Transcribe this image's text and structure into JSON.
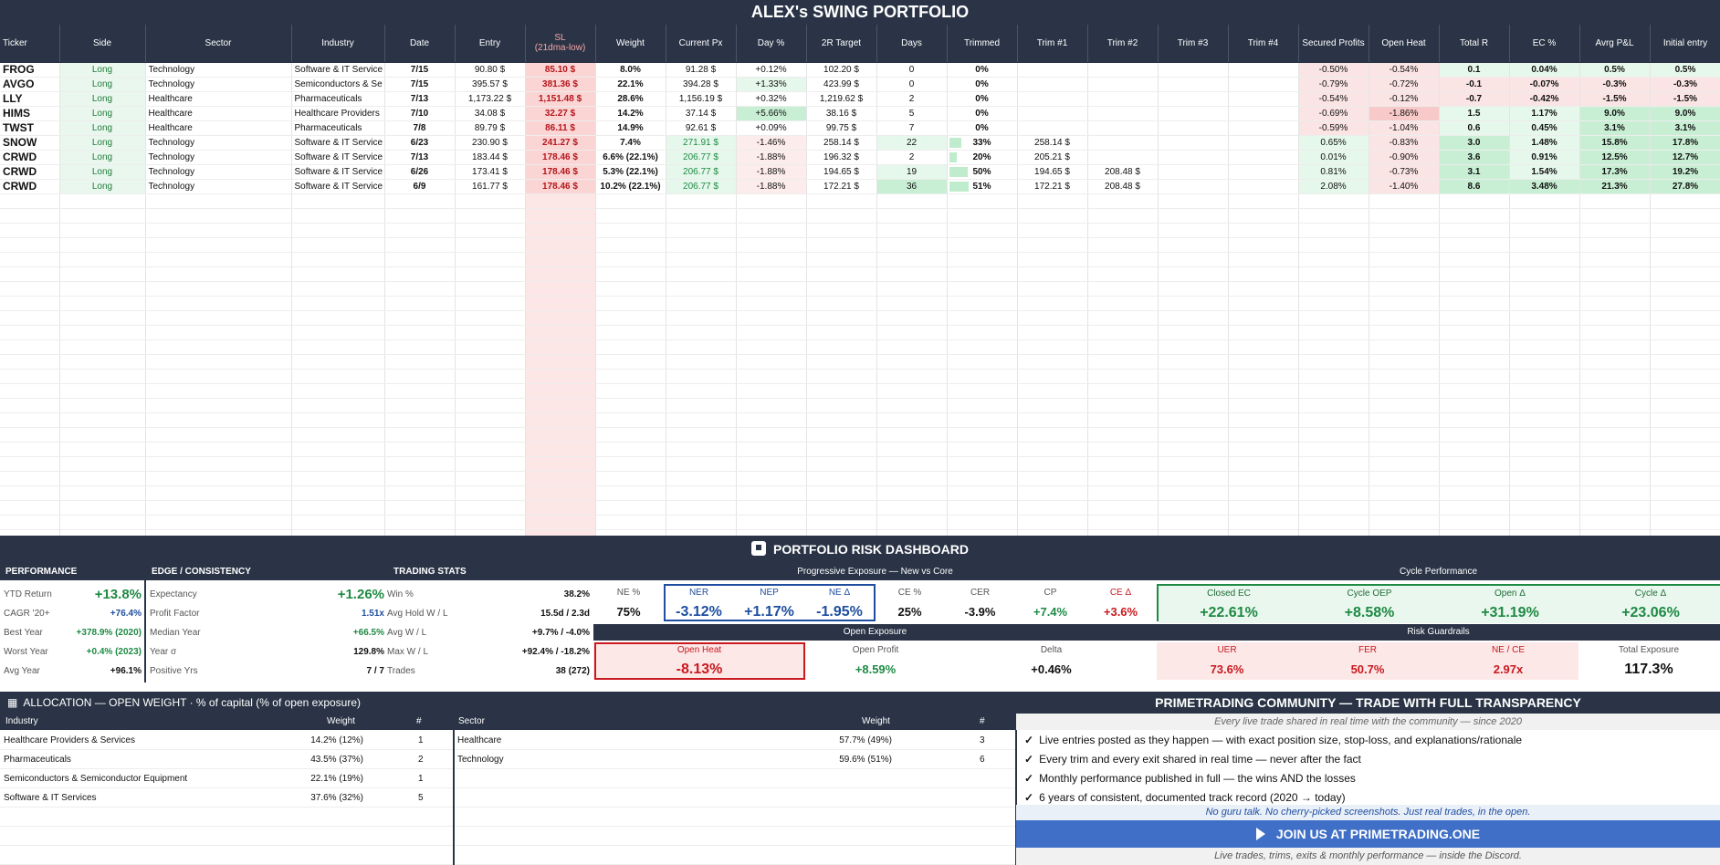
{
  "title": "ALEX's SWING PORTFOLIO",
  "columns": [
    "Ticker",
    "Side",
    "Sector",
    "Industry",
    "Date",
    "Entry",
    "SL",
    "(21dma-low)",
    "Weight",
    "Current Px",
    "Day %",
    "2R Target",
    "Days",
    "Trimmed",
    "Trim #1",
    "Trim #2",
    "Trim #3",
    "Trim #4",
    "Secured Profits",
    "Open Heat",
    "Total R",
    "EC %",
    "Avrg P&L",
    "Initial entry"
  ],
  "positions": [
    {
      "ticker": "FROG",
      "side": "Long",
      "sector": "Technology",
      "industry": "Software & IT Service",
      "date": "7/15",
      "entry": "90.80 $",
      "sl": "85.10 $",
      "weight": "8.0%",
      "current": "91.28 $",
      "day": "+0.12%",
      "target": "102.20 $",
      "days": "0",
      "trimmed": "0%",
      "trim_pct": 0,
      "trim1": "",
      "trim2": "",
      "secured": "-0.50%",
      "heat": "-0.54%",
      "total_r": "0.1",
      "ec": "0.04%",
      "avg_pl": "0.5%",
      "initial": "0.5%"
    },
    {
      "ticker": "AVGO",
      "side": "Long",
      "sector": "Technology",
      "industry": "Semiconductors & Se",
      "date": "7/15",
      "entry": "395.57 $",
      "sl": "381.36 $",
      "weight": "22.1%",
      "current": "394.28 $",
      "day": "+1.33%",
      "target": "423.99 $",
      "days": "0",
      "trimmed": "0%",
      "trim_pct": 0,
      "trim1": "",
      "trim2": "",
      "secured": "-0.79%",
      "heat": "-0.72%",
      "total_r": "-0.1",
      "ec": "-0.07%",
      "avg_pl": "-0.3%",
      "initial": "-0.3%"
    },
    {
      "ticker": "LLY",
      "side": "Long",
      "sector": "Healthcare",
      "industry": "Pharmaceuticals",
      "date": "7/13",
      "entry": "1,173.22 $",
      "sl": "1,151.48 $",
      "weight": "28.6%",
      "current": "1,156.19 $",
      "day": "+0.32%",
      "target": "1,219.62 $",
      "days": "2",
      "trimmed": "0%",
      "trim_pct": 0,
      "trim1": "",
      "trim2": "",
      "secured": "-0.54%",
      "heat": "-0.12%",
      "total_r": "-0.7",
      "ec": "-0.42%",
      "avg_pl": "-1.5%",
      "initial": "-1.5%"
    },
    {
      "ticker": "HIMS",
      "side": "Long",
      "sector": "Healthcare",
      "industry": "Healthcare Providers",
      "date": "7/10",
      "entry": "34.08 $",
      "sl": "32.27 $",
      "weight": "14.2%",
      "current": "37.14 $",
      "day": "+5.66%",
      "target": "38.16 $",
      "days": "5",
      "trimmed": "0%",
      "trim_pct": 0,
      "trim1": "",
      "trim2": "",
      "secured": "-0.69%",
      "heat": "-1.86%",
      "total_r": "1.5",
      "ec": "1.17%",
      "avg_pl": "9.0%",
      "initial": "9.0%"
    },
    {
      "ticker": "TWST",
      "side": "Long",
      "sector": "Healthcare",
      "industry": "Pharmaceuticals",
      "date": "7/8",
      "entry": "89.79 $",
      "sl": "86.11 $",
      "weight": "14.9%",
      "current": "92.61 $",
      "day": "+0.09%",
      "target": "99.75 $",
      "days": "7",
      "trimmed": "0%",
      "trim_pct": 0,
      "trim1": "",
      "trim2": "",
      "secured": "-0.59%",
      "heat": "-1.04%",
      "total_r": "0.6",
      "ec": "0.45%",
      "avg_pl": "3.1%",
      "initial": "3.1%"
    },
    {
      "ticker": "SNOW",
      "side": "Long",
      "sector": "Technology",
      "industry": "Software & IT Service",
      "date": "6/23",
      "entry": "230.90 $",
      "sl": "241.27 $",
      "weight": "7.4%",
      "current": "271.91 $",
      "day": "-1.46%",
      "target": "258.14 $",
      "days": "22",
      "trimmed": "33%",
      "trim_pct": 33,
      "trim1": "258.14 $",
      "trim2": "",
      "secured": "0.65%",
      "heat": "-0.83%",
      "total_r": "3.0",
      "ec": "1.48%",
      "avg_pl": "15.8%",
      "initial": "17.8%"
    },
    {
      "ticker": "CRWD",
      "side": "Long",
      "sector": "Technology",
      "industry": "Software & IT Service",
      "date": "7/13",
      "entry": "183.44 $",
      "sl": "178.46 $",
      "weight": "6.6% (22.1%)",
      "current": "206.77 $",
      "day": "-1.88%",
      "target": "196.32 $",
      "days": "2",
      "trimmed": "20%",
      "trim_pct": 20,
      "trim1": "205.21 $",
      "trim2": "",
      "secured": "0.01%",
      "heat": "-0.90%",
      "total_r": "3.6",
      "ec": "0.91%",
      "avg_pl": "12.5%",
      "initial": "12.7%"
    },
    {
      "ticker": "CRWD",
      "side": "Long",
      "sector": "Technology",
      "industry": "Software & IT Service",
      "date": "6/26",
      "entry": "173.41 $",
      "sl": "178.46 $",
      "weight": "5.3% (22.1%)",
      "current": "206.77 $",
      "day": "-1.88%",
      "target": "194.65 $",
      "days": "19",
      "trimmed": "50%",
      "trim_pct": 50,
      "trim1": "194.65 $",
      "trim2": "208.48 $",
      "secured": "0.81%",
      "heat": "-0.73%",
      "total_r": "3.1",
      "ec": "1.54%",
      "avg_pl": "17.3%",
      "initial": "19.2%"
    },
    {
      "ticker": "CRWD",
      "side": "Long",
      "sector": "Technology",
      "industry": "Software & IT Service",
      "date": "6/9",
      "entry": "161.77 $",
      "sl": "178.46 $",
      "weight": "10.2% (22.1%)",
      "current": "206.77 $",
      "day": "-1.88%",
      "target": "172.21 $",
      "days": "36",
      "trimmed": "51%",
      "trim_pct": 51,
      "trim1": "172.21 $",
      "trim2": "208.48 $",
      "secured": "2.08%",
      "heat": "-1.40%",
      "total_r": "8.6",
      "ec": "3.48%",
      "avg_pl": "21.3%",
      "initial": "27.8%"
    }
  ],
  "dashboard": {
    "title": "PORTFOLIO RISK DASHBOARD",
    "performance": {
      "header": "PERFORMANCE",
      "rows": [
        {
          "k": "YTD Return",
          "v": "+13.8%"
        },
        {
          "k": "CAGR '20+",
          "v": "+76.4%"
        },
        {
          "k": "Best Year",
          "v": "+378.9% (2020)"
        },
        {
          "k": "Worst Year",
          "v": "+0.4% (2023)"
        },
        {
          "k": "Avg Year",
          "v": "+96.1%"
        }
      ]
    },
    "edge": {
      "header": "EDGE / CONSISTENCY",
      "rows": [
        {
          "k": "Expectancy",
          "v": "+1.26%"
        },
        {
          "k": "Profit Factor",
          "v": "1.51x"
        },
        {
          "k": "Median Year",
          "v": "+66.5%"
        },
        {
          "k": "Year σ",
          "v": "129.8%"
        },
        {
          "k": "Positive Yrs",
          "v": "7 / 7"
        }
      ]
    },
    "trading": {
      "header": "TRADING STATS",
      "rows": [
        {
          "k": "Win %",
          "v": "38.2%"
        },
        {
          "k": "Avg Hold W / L",
          "v": "15.5d / 2.3d"
        },
        {
          "k": "Avg W / L",
          "v": "+9.7% / -4.0%"
        },
        {
          "k": "Max W / L",
          "v": "+92.4% / -18.2%"
        },
        {
          "k": "Trades",
          "v": "38 (272)"
        }
      ]
    },
    "progressive": {
      "header": "Progressive Exposure  —  New vs Core",
      "cells": [
        {
          "k": "NE %",
          "v": "75%"
        },
        {
          "k": "NER",
          "v": "-3.12%"
        },
        {
          "k": "NEP",
          "v": "+1.17%"
        },
        {
          "k": "NE Δ",
          "v": "-1.95%"
        },
        {
          "k": "CE %",
          "v": "25%"
        },
        {
          "k": "CER",
          "v": "-3.9%"
        },
        {
          "k": "CP",
          "v": "+7.4%"
        },
        {
          "k": "CE Δ",
          "v": "+3.6%"
        }
      ]
    },
    "cycle": {
      "header": "Cycle Performance",
      "cells": [
        {
          "k": "Closed EC",
          "v": "+22.61%"
        },
        {
          "k": "Cycle OEP",
          "v": "+8.58%"
        },
        {
          "k": "Open Δ",
          "v": "+31.19%"
        },
        {
          "k": "Cycle Δ",
          "v": "+23.06%"
        }
      ]
    },
    "open_exposure": {
      "header": "Open Exposure",
      "cells": [
        {
          "k": "Open Heat",
          "v": "-8.13%"
        },
        {
          "k": "Open Profit",
          "v": "+8.59%"
        },
        {
          "k": "Delta",
          "v": "+0.46%"
        }
      ]
    },
    "guardrails": {
      "header": "Risk Guardrails",
      "cells": [
        {
          "k": "UER",
          "v": "73.6%"
        },
        {
          "k": "FER",
          "v": "50.7%"
        },
        {
          "k": "NE / CE",
          "v": "2.97x"
        },
        {
          "k": "Total Exposure",
          "v": "117.3%"
        }
      ]
    }
  },
  "allocation": {
    "title": "ALLOCATION — OPEN WEIGHT  ·  % of capital (% of open exposure)",
    "industry_headers": [
      "Industry",
      "Weight",
      "#"
    ],
    "industries": [
      {
        "name": "Healthcare Providers & Services",
        "weight": "14.2% (12%)",
        "count": "1"
      },
      {
        "name": "Pharmaceuticals",
        "weight": "43.5% (37%)",
        "count": "2"
      },
      {
        "name": "Semiconductors & Semiconductor Equipment",
        "weight": "22.1% (19%)",
        "count": "1"
      },
      {
        "name": "Software & IT Services",
        "weight": "37.6% (32%)",
        "count": "5"
      }
    ],
    "sector_headers": [
      "Sector",
      "Weight",
      "#"
    ],
    "sectors": [
      {
        "name": "Healthcare",
        "weight": "57.7% (49%)",
        "count": "3"
      },
      {
        "name": "Technology",
        "weight": "59.6% (51%)",
        "count": "6"
      }
    ]
  },
  "community": {
    "title": "PRIMETRADING COMMUNITY — TRADE WITH FULL TRANSPARENCY",
    "subtitle": "Every live trade shared in real time with the community — since 2020",
    "bullets": [
      "Live entries posted as they happen — with exact position size, stop-loss, and explanations/rationale",
      "Every trim and every exit shared in real time — never after the fact",
      "Monthly performance published in full — the wins AND the losses",
      "6 years of consistent, documented track record (2020 → today)"
    ],
    "check": "✓",
    "tagline": "No guru talk. No cherry-picked screenshots. Just real trades, in the open.",
    "cta": "JOIN US AT  PRIMETRADING.ONE",
    "footer": "Live trades, trims, exits & monthly performance — inside the Discord."
  }
}
